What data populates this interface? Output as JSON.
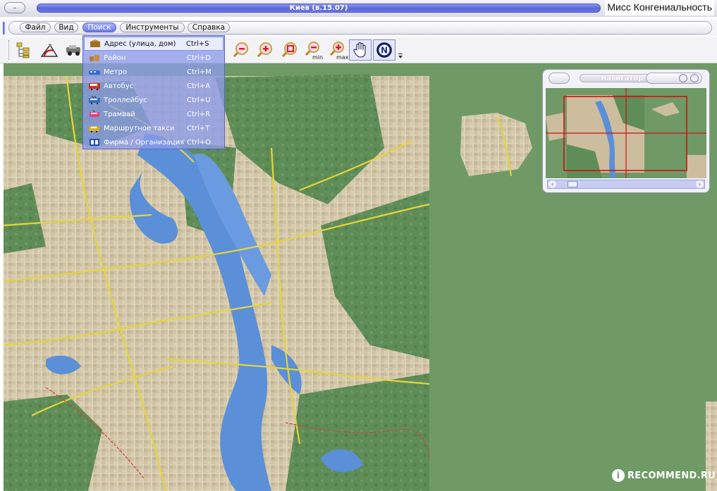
{
  "window": {
    "title": "Киев (в.15.07)",
    "sys_button": "–",
    "overlay_watermark": "Мисс Конгениальность"
  },
  "menubar": {
    "items": [
      {
        "label": "Файл"
      },
      {
        "label": "Вид"
      },
      {
        "label": "Поиск"
      },
      {
        "label": "Инструменты"
      },
      {
        "label": "Справка"
      }
    ],
    "active": "Поиск"
  },
  "toolbar": {
    "tools": [
      "tree-icon",
      "measure-icon",
      "vehicle-icon",
      "zoom-out-icon",
      "zoom-in-icon",
      "zoom-area-icon",
      "zoom-min-icon",
      "zoom-max-icon",
      "hand-pan-icon",
      "north-compass-icon"
    ],
    "zoom_min_label": "min",
    "zoom_max_label": "max",
    "compass_label": "N"
  },
  "search_menu": {
    "items": [
      {
        "label": "Адрес (улица, дом)",
        "shortcut": "Ctrl+S",
        "icon": "address-icon"
      },
      {
        "label": "Район",
        "shortcut": "Ctrl+D",
        "icon": "district-icon"
      },
      {
        "label": "Метро",
        "shortcut": "Ctrl+M",
        "icon": "metro-icon"
      },
      {
        "label": "Автобус",
        "shortcut": "Ctrl+A",
        "icon": "bus-icon"
      },
      {
        "label": "Троллейбус",
        "shortcut": "Ctrl+U",
        "icon": "trolleybus-icon"
      },
      {
        "label": "Трамвай",
        "shortcut": "Ctrl+R",
        "icon": "tram-icon"
      },
      {
        "label": "Маршрутное такси",
        "shortcut": "Ctrl+T",
        "icon": "minibus-icon"
      },
      {
        "label": "Фирма / Организация",
        "shortcut": "Ctrl+O",
        "icon": "company-icon"
      }
    ],
    "selected_index": 0
  },
  "navigator": {
    "title": "Навигатор",
    "scroll_left": "‹",
    "scroll_right": "›"
  },
  "watermark_badge": {
    "glyph": "i",
    "text": "RECOMMEND.RU"
  },
  "colors": {
    "map_green": "#6f9a66",
    "water": "#5b8fd8",
    "city": "#cbbd9e",
    "road": "#e8d83a",
    "accent_blue": "#6c79e6",
    "nav_frame_red": "#d01010"
  }
}
